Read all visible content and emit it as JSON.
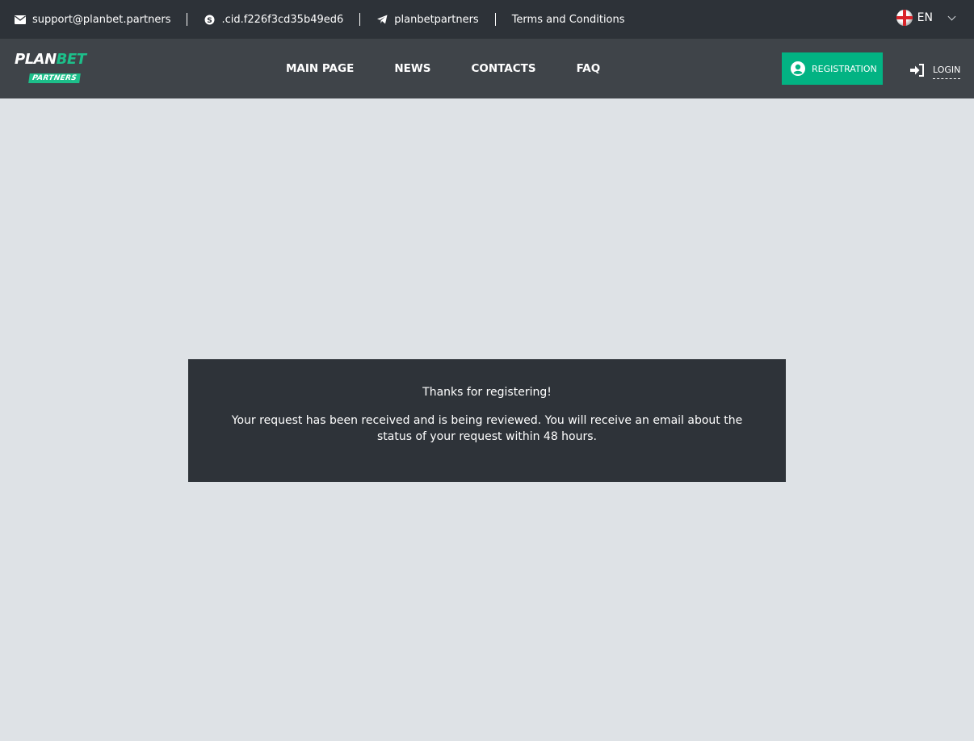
{
  "topbar": {
    "email": "support@planbet.partners",
    "skype": ".cid.f226f3cd35b49ed6",
    "telegram": "planbetpartners",
    "terms": "Terms and Conditions",
    "language": "EN"
  },
  "navbar": {
    "logo_main_1": "PLAN",
    "logo_main_2": "BET",
    "logo_sub": "PARTNERS",
    "menu": [
      "MAIN PAGE",
      "NEWS",
      "CONTACTS",
      "FAQ"
    ],
    "registration_label": "REGISTRATION",
    "login_label": "LOGIN",
    "accent_color": "#02b383"
  },
  "message": {
    "title": "Thanks for registering!",
    "body": "Your request has been received and is being reviewed. You will receive an email about the status of your request within 48 hours."
  }
}
